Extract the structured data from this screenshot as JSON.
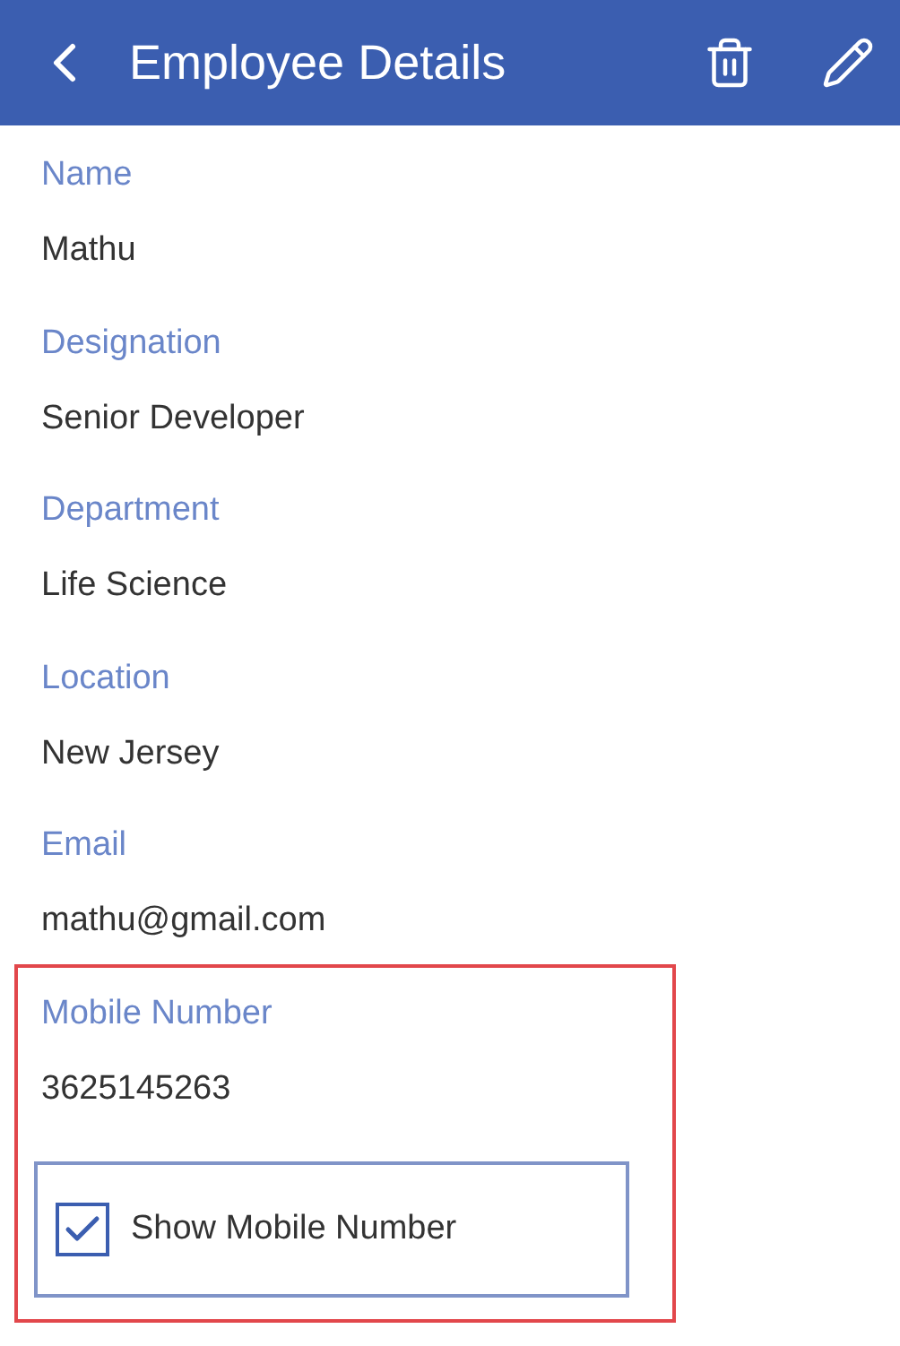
{
  "header": {
    "title": "Employee Details"
  },
  "fields": [
    {
      "label": "Name",
      "value": "Mathu"
    },
    {
      "label": "Designation",
      "value": "Senior Developer"
    },
    {
      "label": "Department",
      "value": "Life Science"
    },
    {
      "label": "Location",
      "value": "New Jersey"
    },
    {
      "label": "Email",
      "value": "mathu@gmail.com"
    }
  ],
  "mobile_section": {
    "highlighted": true,
    "label": "Mobile Number",
    "value": "3625145263",
    "checkbox": {
      "label": "Show Mobile Number",
      "checked": true
    }
  }
}
